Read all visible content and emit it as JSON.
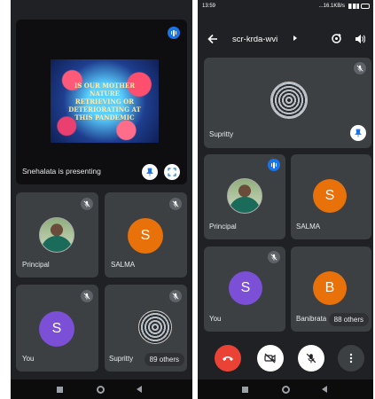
{
  "left_phone": {
    "presentation": {
      "slide_lines": [
        "IS OUR MOTHER",
        "NATURE",
        "RETRIEVING OR",
        "DETERIORATING AT",
        "THIS PANDEMIC"
      ],
      "presenter_text": "Snehalata is presenting"
    },
    "tiles": [
      {
        "name": "Principal"
      },
      {
        "name": "SALMA",
        "initial": "S",
        "color": "#e8710a"
      },
      {
        "name": "You",
        "initial": "S",
        "color": "#7b4fd6"
      },
      {
        "name": "Supritty"
      }
    ],
    "others_label": "89 others"
  },
  "right_phone": {
    "status": {
      "time": "13:59",
      "indicators": "...16.1KB/s"
    },
    "meeting_code": "scr-krda-wvi",
    "top_tile_name": "Supritty",
    "tiles": [
      {
        "name": "Principal"
      },
      {
        "name": "SALMA",
        "initial": "S",
        "color": "#e8710a"
      },
      {
        "name": "You",
        "initial": "S",
        "color": "#7b4fd6"
      },
      {
        "name": "Banibrata",
        "initial": "B",
        "color": "#e8710a"
      }
    ],
    "others_label": "88 others"
  },
  "icons": {
    "mic_off": "mic-off-icon",
    "audio_level": "audio-level-icon",
    "pin": "pin-icon",
    "fullscreen": "fullscreen-icon",
    "back": "arrow-back-icon",
    "switch_camera": "switch-camera-icon",
    "speaker": "speaker-icon",
    "end_call": "end-call-icon",
    "camera_off": "camera-off-icon",
    "more": "more-vert-icon"
  },
  "colors": {
    "background": "#202124",
    "tile": "#3c4043",
    "accent_blue": "#1a73e8",
    "end_call_red": "#ea4335"
  }
}
